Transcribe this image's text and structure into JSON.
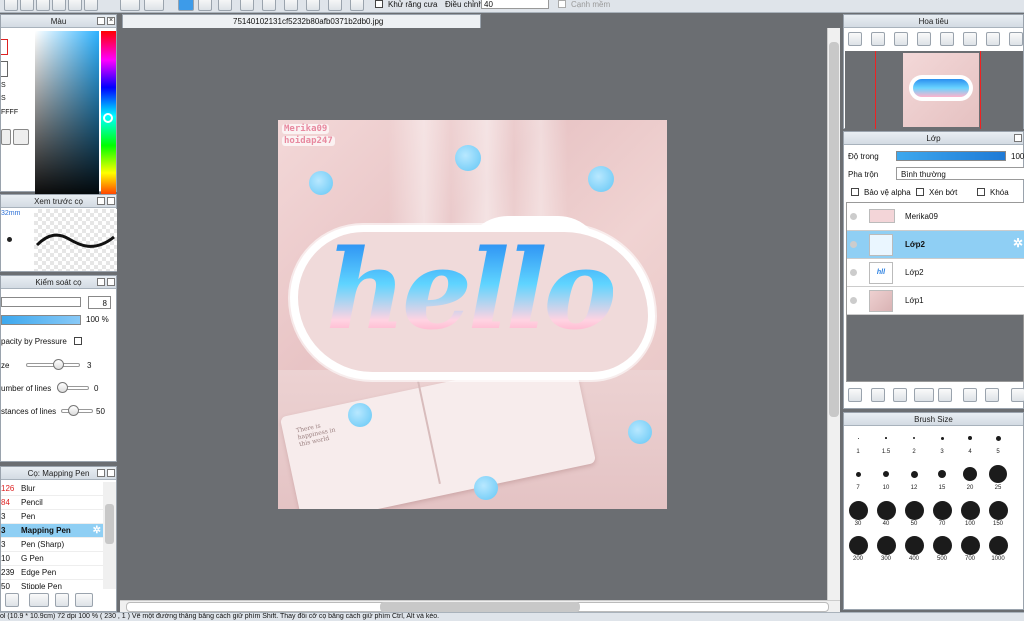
{
  "toolbar": {
    "antialias_label": "Khử răng cưa",
    "adjust_label": "Điều chỉnh",
    "adjust_value": "40",
    "smooth_label": "Cạnh mềm"
  },
  "document_tab": "75140102131cf5232b80afb0371b2db0.jpg",
  "color_panel": {
    "title": "Màu",
    "side_texts": [
      "S",
      "S",
      "FFFF"
    ]
  },
  "brush_preview_panel": {
    "title": "Xem trước cọ",
    "size_text": "32mm"
  },
  "brush_control_panel": {
    "title": "Kiểm soát cọ",
    "size_value": "8",
    "opacity_value": "100 %",
    "opacity_pressure": "pacity by Pressure",
    "rows": [
      {
        "label": "ze",
        "value": "3"
      },
      {
        "label": "umber of lines",
        "value": "0"
      },
      {
        "label": "stances of lines",
        "value": "50"
      }
    ]
  },
  "brush_list_panel": {
    "title": "Cọ: Mapping Pen",
    "items": [
      {
        "num": "126",
        "name": "Blur",
        "selected": false
      },
      {
        "num": "84",
        "name": "Pencil",
        "selected": false
      },
      {
        "num": "3",
        "name": "Pen",
        "selected": false
      },
      {
        "num": "3",
        "name": "Mapping Pen",
        "selected": true
      },
      {
        "num": "3",
        "name": "Pen (Sharp)",
        "selected": false
      },
      {
        "num": "10",
        "name": "G Pen",
        "selected": false
      },
      {
        "num": "239",
        "name": "Edge Pen",
        "selected": false
      },
      {
        "num": "50",
        "name": "Stipple Pen",
        "selected": false
      }
    ]
  },
  "canvas": {
    "watermark": [
      "Merika09",
      "hoidap247"
    ],
    "art_text": "hello"
  },
  "navigator_panel": {
    "title": "Hoa tiêu"
  },
  "layer_panel": {
    "title": "Lớp",
    "opacity_label": "Độ trong",
    "opacity_value": "100",
    "blend_label": "Pha trộn",
    "blend_value": "Bình thường",
    "protect_alpha": "Bảo vệ alpha",
    "clipping": "Xén bớt",
    "lock": "Khóa",
    "layers": [
      {
        "name": "Merika09",
        "selected": false
      },
      {
        "name": "Lớp2",
        "selected": true
      },
      {
        "name": "Lớp2",
        "selected": false
      },
      {
        "name": "Lớp1",
        "selected": false
      }
    ]
  },
  "brush_size_panel": {
    "title": "Brush Size",
    "sizes": [
      "1",
      "1.5",
      "2",
      "3",
      "4",
      "5",
      "7",
      "10",
      "12",
      "15",
      "20",
      "25",
      "30",
      "40",
      "50",
      "70",
      "100",
      "150",
      "200",
      "300",
      "400",
      "500",
      "700",
      "1000"
    ]
  },
  "status_bar": {
    "text": "ol (10.9 * 10.9cm)  72 dpi  100 %  (  230 , 1 )  Vẽ một đường thẳng bằng cách giữ phím Shift. Thay đổi cỡ cọ bằng cách giữ phím Ctrl, Alt và kéo."
  }
}
